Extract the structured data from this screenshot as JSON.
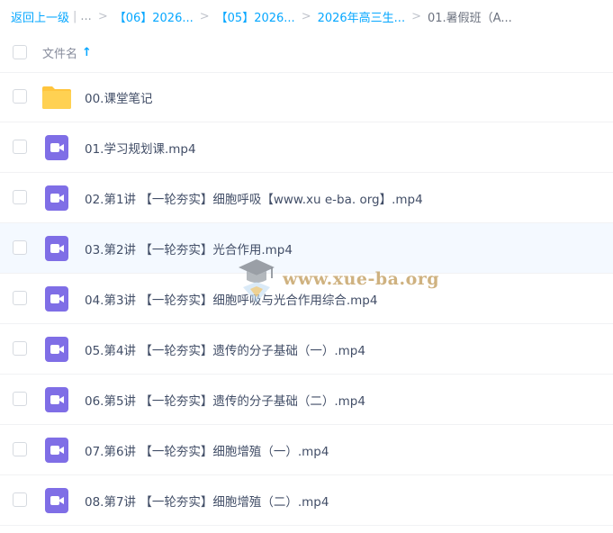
{
  "breadcrumb": {
    "back": "返回上一级",
    "more": "...",
    "items": [
      "【06】2026...",
      "【05】2026...",
      "2026年高三生..."
    ],
    "current": "01.暑假班（A..."
  },
  "header": {
    "name_label": "文件名",
    "sort_arrow": "↑"
  },
  "files": [
    {
      "name": "00.课堂笔记",
      "type": "folder"
    },
    {
      "name": "01.学习规划课.mp4",
      "type": "video"
    },
    {
      "name": "02.第1讲 【一轮夯实】细胞呼吸【www.xu e-ba. org】.mp4",
      "type": "video"
    },
    {
      "name": "03.第2讲 【一轮夯实】光合作用.mp4",
      "type": "video"
    },
    {
      "name": "04.第3讲 【一轮夯实】细胞呼吸与光合作用综合.mp4",
      "type": "video"
    },
    {
      "name": "05.第4讲 【一轮夯实】遗传的分子基础（一）.mp4",
      "type": "video"
    },
    {
      "name": "06.第5讲 【一轮夯实】遗传的分子基础（二）.mp4",
      "type": "video"
    },
    {
      "name": "07.第6讲 【一轮夯实】细胞增殖（一）.mp4",
      "type": "video"
    },
    {
      "name": "08.第7讲 【一轮夯实】细胞增殖（二）.mp4",
      "type": "video"
    }
  ],
  "watermark": {
    "text": "www.xue-ba.org"
  },
  "colors": {
    "accent": "#06a7ff",
    "folder": "#ffd152",
    "video": "#7f6ee6",
    "hover_row": "#f4f9ff"
  }
}
